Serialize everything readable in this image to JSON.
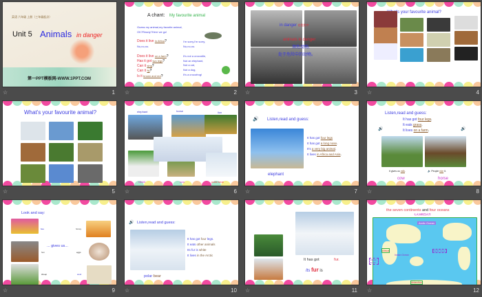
{
  "colors": {
    "pink": "#f24aa0",
    "mint": "#a9e8cc",
    "yellow": "#f7ef8c",
    "peach": "#f9c89c",
    "bg": "#4b4b4b"
  },
  "slides": [
    {
      "num": "1",
      "subtitle": "英语 六年级 上册（三年级起点）",
      "unit": "Unit 5",
      "title1": "Animals",
      "title2": "in danger",
      "footer": "第一PPT模板网-WWW.1PPT.COM"
    },
    {
      "num": "2",
      "heading": "A chant:",
      "heading2": "My favourite  animal",
      "intro": "Guess my animal,my favorite animal,",
      "intro2": "OK?Ready?Here we go!",
      "q1": "Does it live",
      "q1a": "in Africa",
      "no": "No,no,no.",
      "sorry": "I'm sorry,I'm sorry,",
      "sorry2": "No,no,no.",
      "q2": "Does it live",
      "q2a": "on a farm",
      "q3": "Has it got",
      "q3a": "two legs",
      "q4": "Can it",
      "q4a": "sing",
      "q5": "Can it",
      "q5a": "fly",
      "q6": "Is it",
      "q6a": "brown and red",
      "a1": "It's not a crocodile,",
      "a2": "Not an elephant,",
      "a3": "Not a cat,",
      "a4": "Not a dog,",
      "a5": "It's a crocofrog!"
    },
    {
      "num": "3",
      "l1": "in danger",
      "l1b": "在危险中",
      "l2": "animals in danger",
      "l3": "濒危动物,",
      "l4": "处于危险中的动物。"
    },
    {
      "num": "4",
      "heading": "What's your favourite  animal?"
    },
    {
      "num": "5",
      "heading": "What's your favourite  animal?"
    },
    {
      "num": "6",
      "elephant": "elephant",
      "horse": "horse",
      "lion": "lion",
      "rabbit": "rabbit",
      "cow": "cow",
      "polar": "polar bear"
    },
    {
      "num": "7",
      "heading": "Listen,read and guess:",
      "s1": "It has got",
      "s1a": "four legs",
      "s2": "It has got",
      "s2a": "a long nose",
      "s3": "It's",
      "s3a": "a very big animal",
      "s4": "It lives",
      "s4a": "in Africa and Asia",
      "answer": "elephant"
    },
    {
      "num": "8",
      "heading": "Listen,read and guess:",
      "s1": "It has got",
      "s1a": "four legs",
      "s2": "It eats",
      "s2a": "grass",
      "s3": "It lives",
      "s3a": "on a farm",
      "c1": "It gives us",
      "c1a": "milk",
      "c2": "People",
      "c2a": "ride",
      "c2b": "it.",
      "cow": "cow",
      "horse": "horse"
    },
    {
      "num": "9",
      "heading": "Look and say:",
      "bee": "bee",
      "honey": "honey",
      "hen": "hen",
      "eggs": "eggs",
      "sheep": "sheep",
      "wool": "wool",
      "gives": "... gives  us..."
    },
    {
      "num": "10",
      "heading": "Listen,read and guess:",
      "s1": "It has got",
      "s1a": "four",
      "s1b": "legs.",
      "s2": "It eats",
      "s2a": "other animals",
      "s3": "Its fur is",
      "s3a": "white",
      "s4": "It lives",
      "s4a": "in the Arctic",
      "answer1": "polar",
      "answer2": "bear"
    },
    {
      "num": "11",
      "s1": "It has got",
      "s1a": "fur.",
      "s2": "Its",
      "s2a": "fur",
      "s2b": "is"
    },
    {
      "num": "12",
      "title1": "the seven continents",
      "title2": "and",
      "title3": "four oceans",
      "sub": "七大洲和四大洋",
      "arctic": "Arctic Ocean",
      "africa": "Africa",
      "indian": "Indian Ocean",
      "pacific": "Pacific Ocean",
      "atlantic": "Atlantic Ocean",
      "antarctica": "Antarctica"
    }
  ]
}
